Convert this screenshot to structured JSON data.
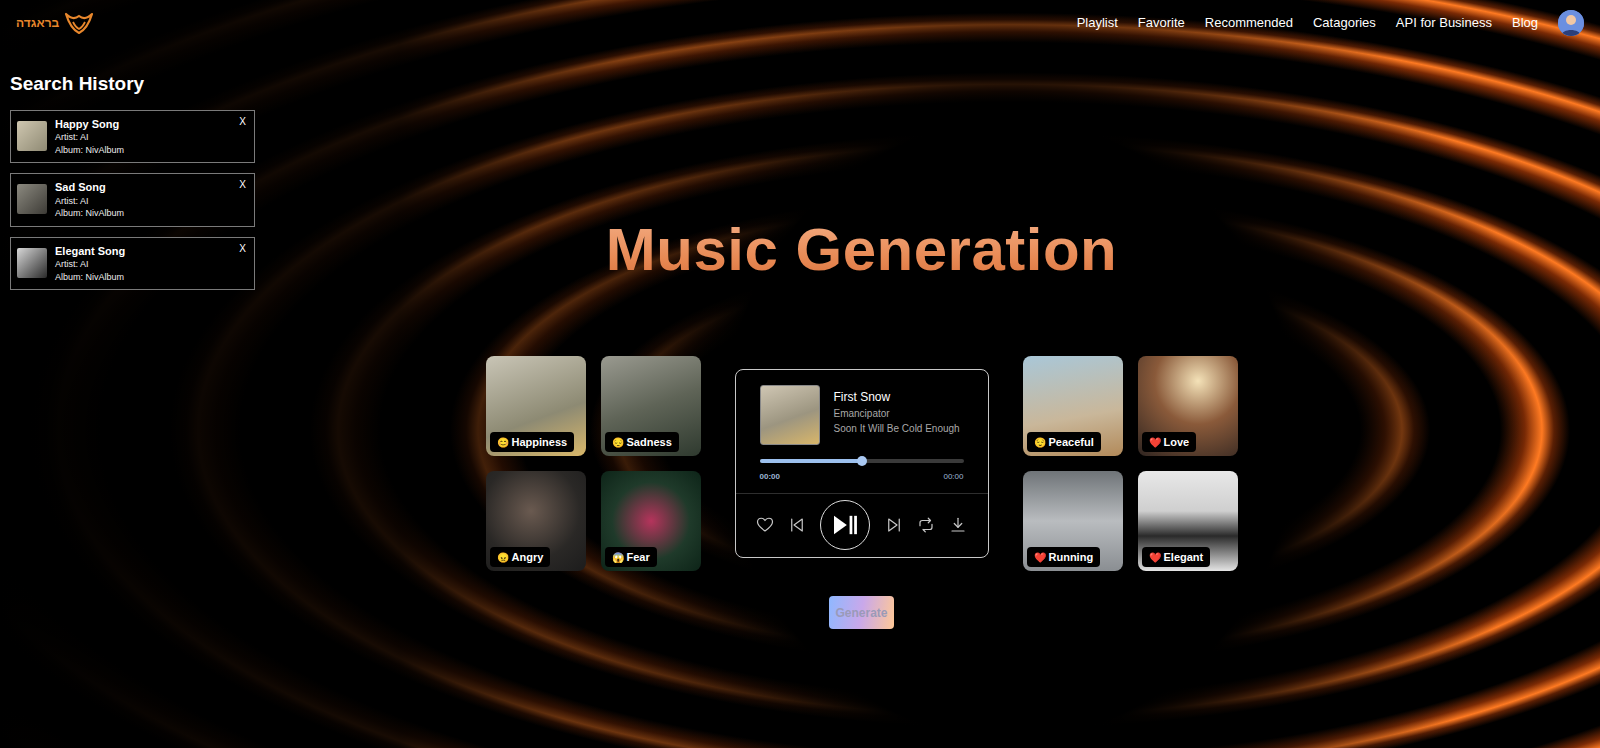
{
  "logo": {
    "text": "בראגדה"
  },
  "nav": [
    {
      "label": "Playlist"
    },
    {
      "label": "Favorite"
    },
    {
      "label": "Recommended"
    },
    {
      "label": "Catagories"
    },
    {
      "label": "API for Business"
    },
    {
      "label": "Blog"
    }
  ],
  "sidebar": {
    "title": "Search History",
    "items": [
      {
        "title": "Happy Song",
        "artist": "Artist: AI",
        "album": "Album: NivAlbum",
        "close": "X"
      },
      {
        "title": "Sad Song",
        "artist": "Artist: AI",
        "album": "Album: NivAlbum",
        "close": "X"
      },
      {
        "title": "Elegant Song",
        "artist": "Artist: AI",
        "album": "Album: NivAlbum",
        "close": "X"
      }
    ]
  },
  "hero": {
    "title": "Music Generation"
  },
  "moods_left": [
    {
      "icon": "😊",
      "label": "Happiness"
    },
    {
      "icon": "😔",
      "label": "Sadness"
    },
    {
      "icon": "😠",
      "label": "Angry"
    },
    {
      "icon": "😱",
      "label": "Fear"
    }
  ],
  "moods_right": [
    {
      "icon": "😌",
      "label": "Peaceful"
    },
    {
      "icon": "❤️",
      "label": "Love"
    },
    {
      "icon": "❤️",
      "label": "Running"
    },
    {
      "icon": "❤️",
      "label": "Elegant"
    }
  ],
  "player": {
    "title": "First Snow",
    "artist": "Emancipator",
    "album": "Soon It Will Be Cold Enough",
    "level": 0.5,
    "elapsed": "00:00",
    "duration": "00:00",
    "liked": false
  },
  "generate": {
    "label": "Generate",
    "disabled": true
  }
}
